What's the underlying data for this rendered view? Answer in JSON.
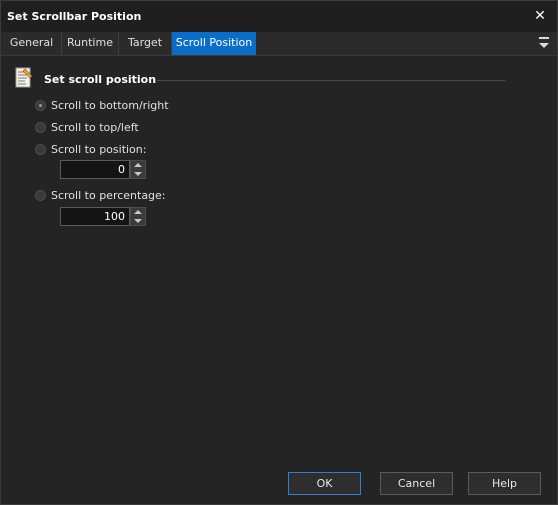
{
  "window": {
    "title": "Set Scrollbar Position"
  },
  "tabs": [
    {
      "label": "General"
    },
    {
      "label": "Runtime"
    },
    {
      "label": "Target"
    },
    {
      "label": "Scroll Position",
      "active": true
    }
  ],
  "section": {
    "title": "Set scroll position",
    "icon": "document-settings-icon"
  },
  "options": [
    {
      "label": "Scroll to bottom/right",
      "checked": true
    },
    {
      "label": "Scroll to top/left",
      "checked": false
    },
    {
      "label": "Scroll to position:",
      "checked": false
    },
    {
      "label": "Scroll to percentage:",
      "checked": false
    }
  ],
  "position_value": "0",
  "percentage_value": "100",
  "buttons": {
    "ok": "OK",
    "cancel": "Cancel",
    "help": "Help"
  },
  "colors": {
    "accent": "#0a6ec8",
    "background": "#242424"
  }
}
